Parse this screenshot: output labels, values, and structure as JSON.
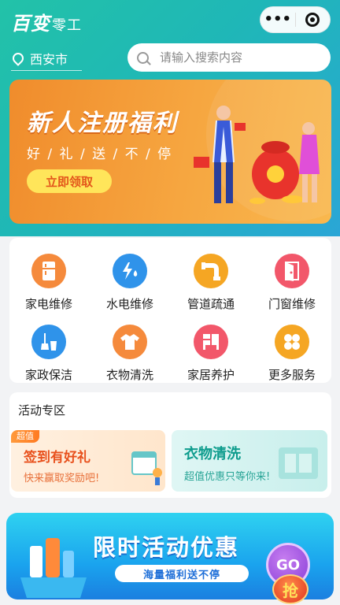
{
  "header": {
    "logo_main": "百变",
    "logo_sub": "零工",
    "menu_dots": "•••"
  },
  "location": {
    "city": "西安市"
  },
  "search": {
    "placeholder": "请输入搜索内容"
  },
  "banner": {
    "title": "新人注册福利",
    "subtitle": "好 / 礼 / 送 / 不 / 停",
    "button": "立即领取"
  },
  "services": [
    {
      "label": "家电维修",
      "icon": "fridge-icon",
      "color": "#f58a3c"
    },
    {
      "label": "水电维修",
      "icon": "bolt-drop-icon",
      "color": "#2f93ea"
    },
    {
      "label": "管道疏通",
      "icon": "pipe-icon",
      "color": "#f5a623"
    },
    {
      "label": "门窗维修",
      "icon": "door-icon",
      "color": "#f2576a"
    },
    {
      "label": "家政保洁",
      "icon": "cleaning-icon",
      "color": "#2f93ea"
    },
    {
      "label": "衣物清洗",
      "icon": "shirt-icon",
      "color": "#f58a3c"
    },
    {
      "label": "家居养护",
      "icon": "furniture-icon",
      "color": "#f2576a"
    },
    {
      "label": "更多服务",
      "icon": "grid-more-icon",
      "color": "#f5a623"
    }
  ],
  "activity": {
    "title": "活动专区",
    "card1": {
      "badge": "超值",
      "title": "签到有好礼",
      "subtitle": "快来赢取奖励吧!"
    },
    "card2": {
      "title": "衣物清洗",
      "subtitle": "超值优惠只等你来!"
    }
  },
  "promo": {
    "title": "限时活动优惠",
    "subtitle": "海量福利送不停",
    "go": "GO",
    "grab": "抢"
  }
}
